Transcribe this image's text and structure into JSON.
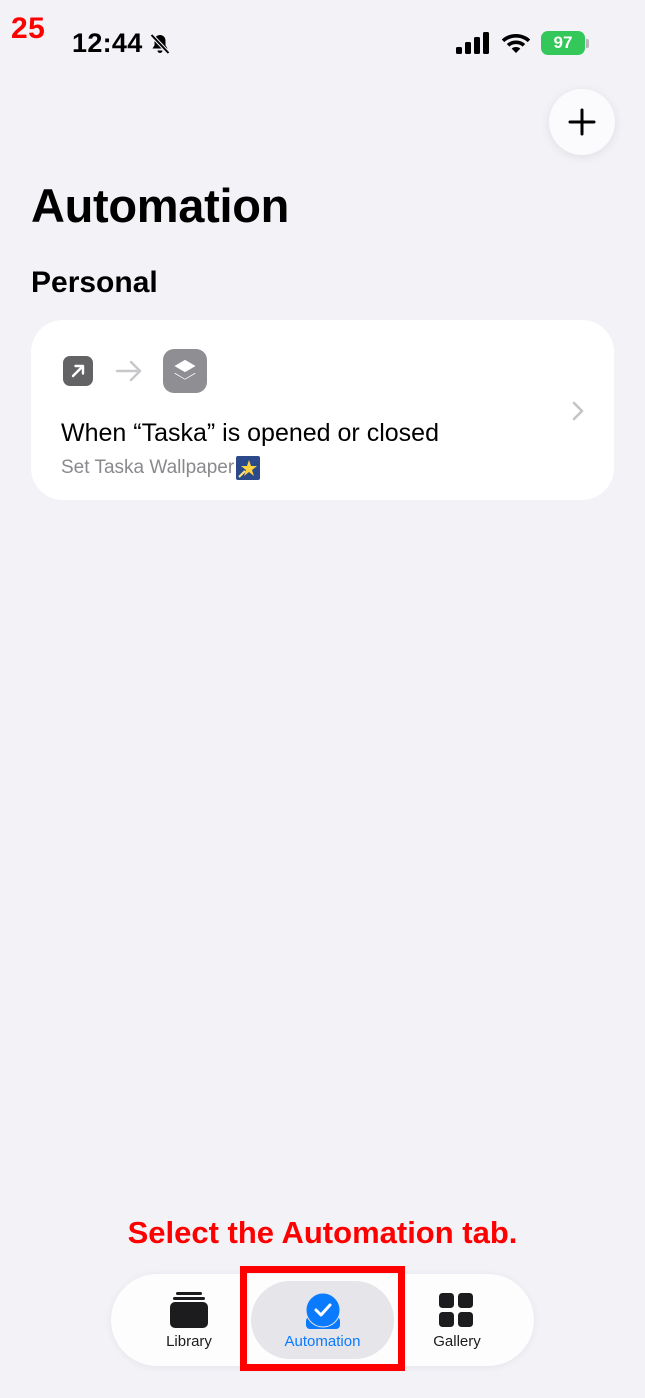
{
  "step": "25",
  "status_bar": {
    "time": "12:44",
    "battery": "97"
  },
  "header": {
    "title": "Automation"
  },
  "section": {
    "title": "Personal"
  },
  "automation": {
    "title": "When “Taska” is opened or closed",
    "subtitle": "Set Taska Wallpaper"
  },
  "instruction": "Select the Automation tab.",
  "tabs": [
    {
      "label": "Library"
    },
    {
      "label": "Automation"
    },
    {
      "label": "Gallery"
    }
  ],
  "colors": {
    "accent": "#0a7aff",
    "annotation": "#ff0000",
    "battery": "#34c759"
  },
  "icons": [
    "bell-slash-icon",
    "signal-icon",
    "wifi-icon",
    "battery-icon",
    "plus-icon",
    "app-opened-icon",
    "arrow-right-icon",
    "shortcuts-app-icon",
    "star-icon",
    "chevron-right-icon",
    "library-icon",
    "automation-icon",
    "gallery-icon"
  ]
}
